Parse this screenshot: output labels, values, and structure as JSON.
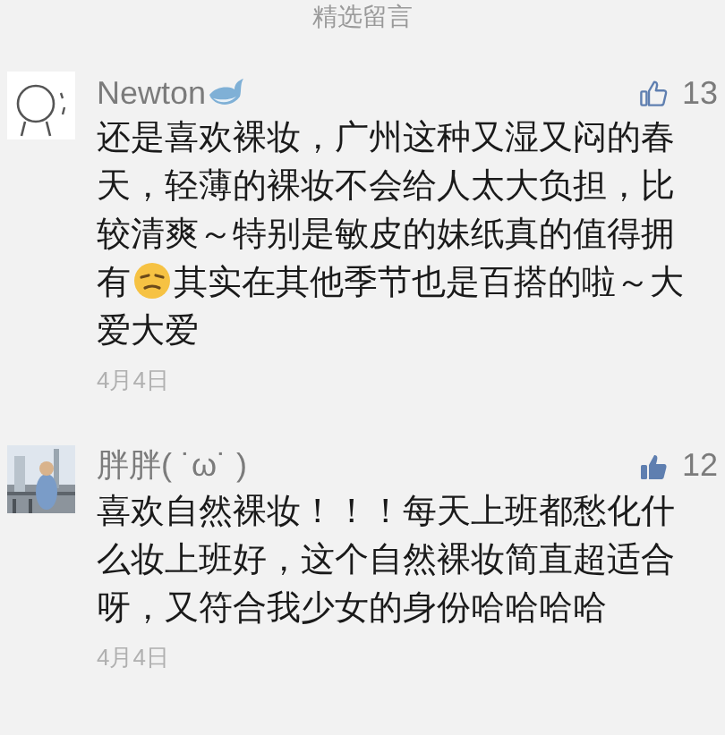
{
  "section_title": "精选留言",
  "comments": [
    {
      "name": "Newton",
      "name_emoji": true,
      "liked": false,
      "likes": "13",
      "avatar": {
        "kind": "drawing"
      },
      "text_before": "还是喜欢裸妆，广州这种又湿又闷的春天，轻薄的裸妆不会给人太大负担，比较清爽～特别是敏皮的妹纸真的值得拥有",
      "text_after": "其实在其他季节也是百搭的啦～大爱大爱",
      "date": "4月4日"
    },
    {
      "name": "胖胖( ˙ω˙ )",
      "name_emoji": false,
      "liked": true,
      "likes": "12",
      "text_before": "喜欢自然裸妆！！！每天上班都愁化什么妆上班好，这个自然裸妆简直超适合呀，又符合我少女的身份哈哈哈哈",
      "date": "4月4日"
    }
  ]
}
